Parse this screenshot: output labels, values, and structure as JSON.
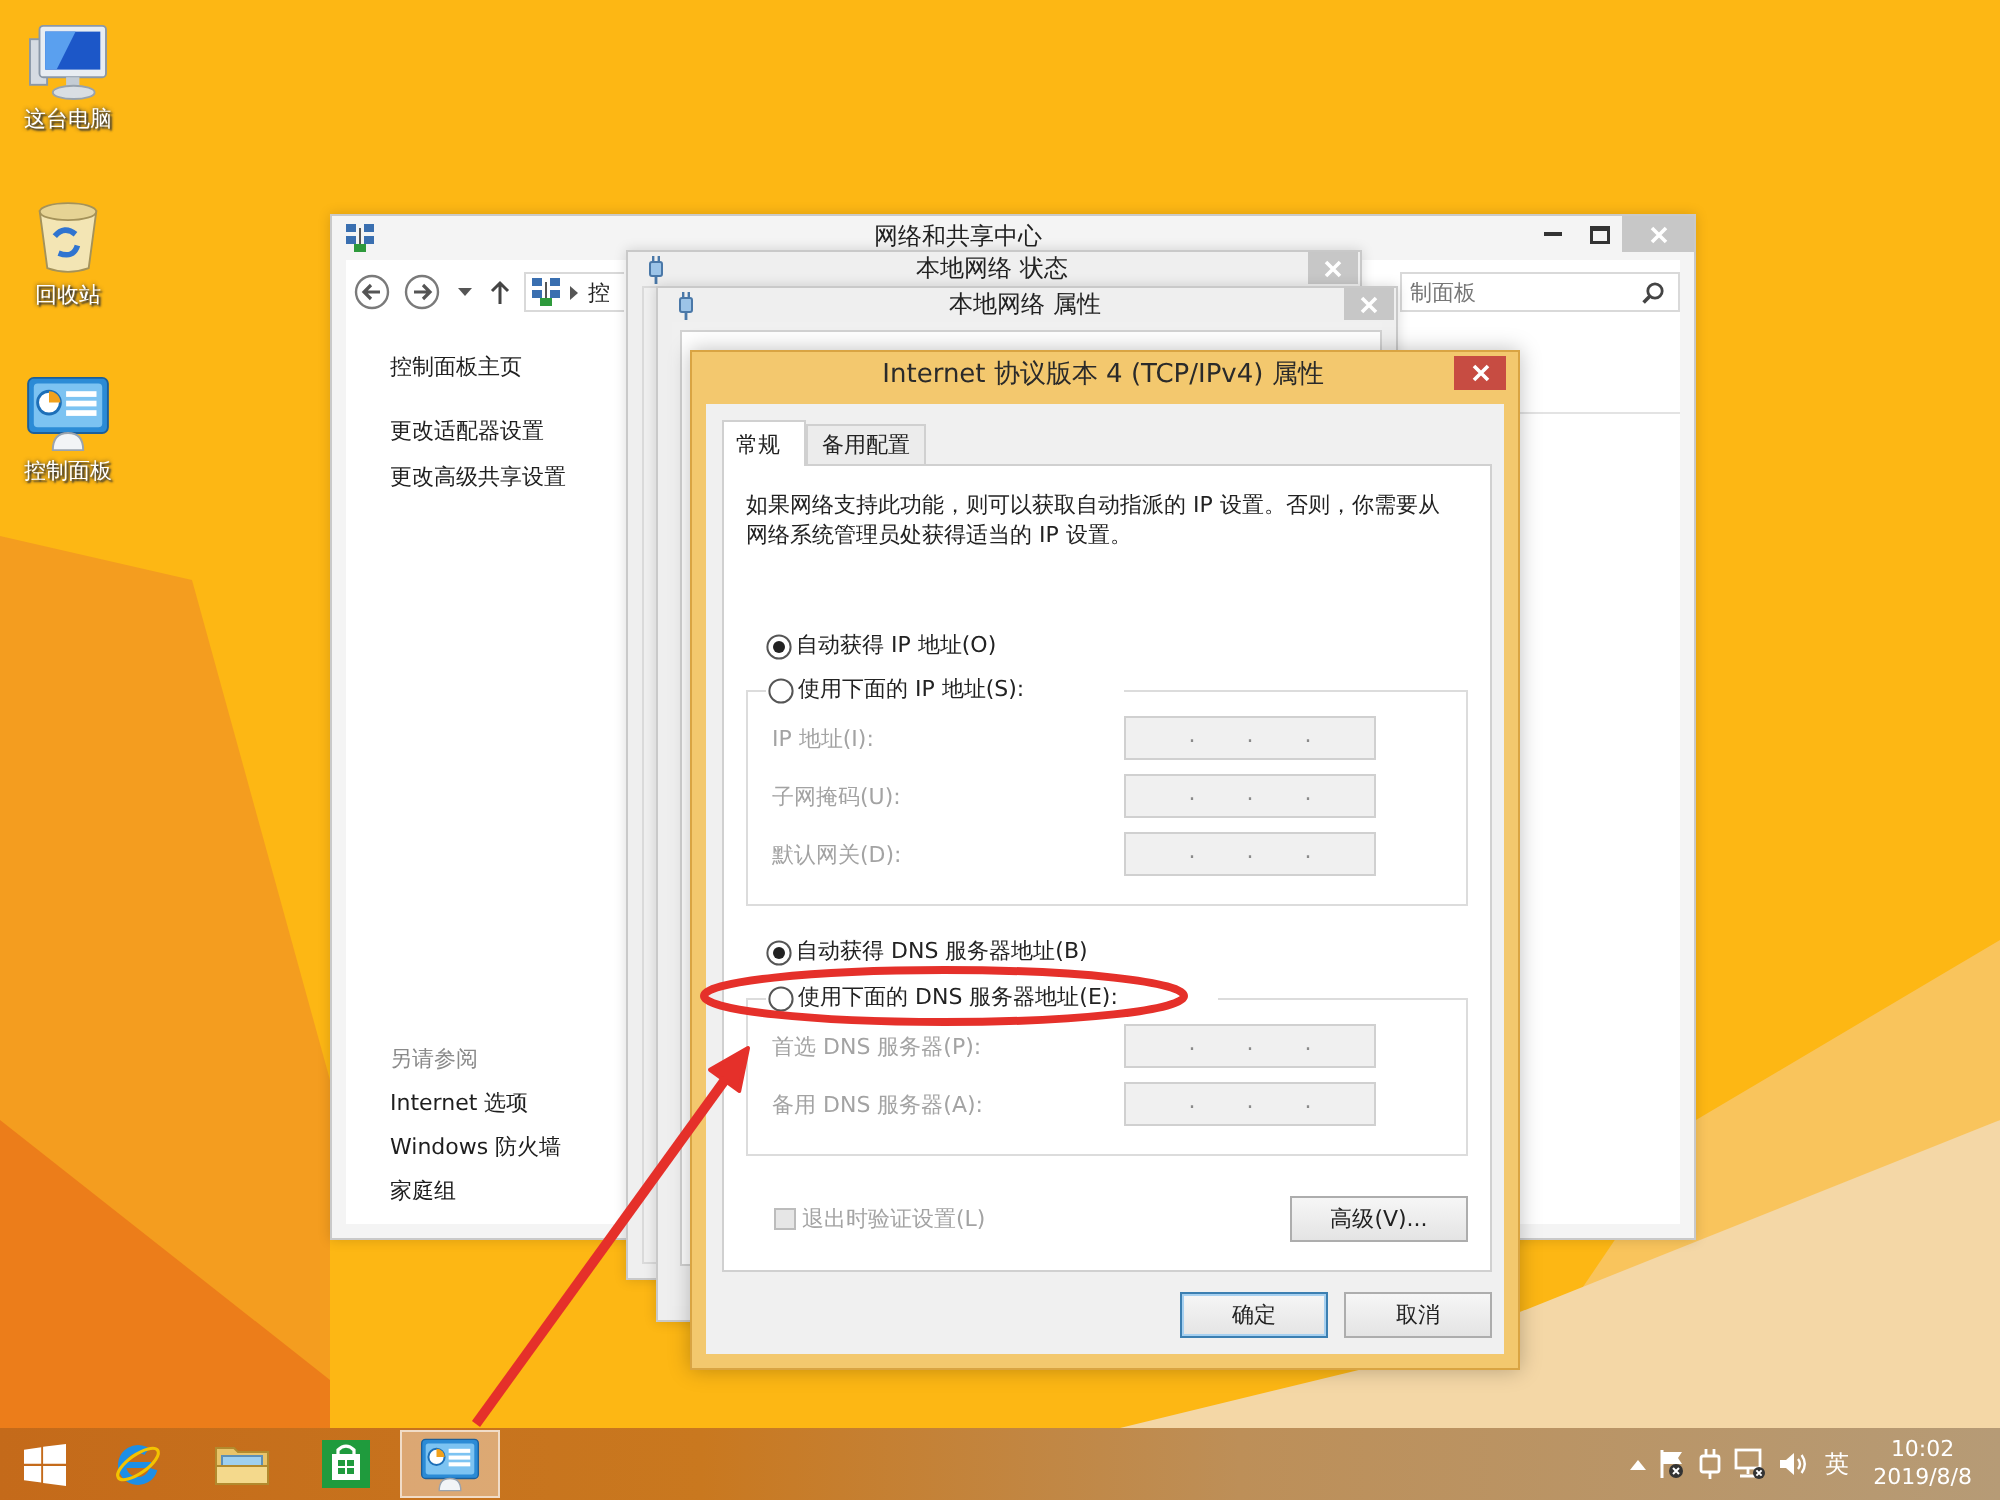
{
  "desktop_icons": [
    {
      "kind": "computer",
      "label": "这台电脑"
    },
    {
      "kind": "recycle_bin",
      "label": "回收站"
    },
    {
      "kind": "control_panel",
      "label": "控制面板"
    }
  ],
  "network_center": {
    "title": "网络和共享中心",
    "address_text": "控",
    "search_text": "制面板",
    "tasks": [
      "控制面板主页",
      "更改适配器设置",
      "更改高级共享设置"
    ],
    "see_also_heading": "另请参阅",
    "see_also": [
      "Internet 选项",
      "Windows 防火墙",
      "家庭组"
    ]
  },
  "status_window": {
    "title": "本地网络 状态"
  },
  "properties_window": {
    "title": "本地网络 属性"
  },
  "dialog": {
    "title": "Internet 协议版本 4 (TCP/IPv4) 属性",
    "tabs": [
      {
        "label": "常规",
        "selected": true
      },
      {
        "label": "备用配置",
        "selected": false
      }
    ],
    "description": "如果网络支持此功能，则可以获取自动指派的 IP 设置。否则，你需要从网络系统管理员处获得适当的 IP 设置。",
    "ip_options": [
      {
        "label": "自动获得 IP 地址(O)",
        "selected": true
      },
      {
        "label": "使用下面的 IP 地址(S):",
        "selected": false
      }
    ],
    "ip_fields": [
      {
        "label": "IP 地址(I):",
        "value": ". . .",
        "disabled": true
      },
      {
        "label": "子网掩码(U):",
        "value": ". . .",
        "disabled": true
      },
      {
        "label": "默认网关(D):",
        "value": ". . .",
        "disabled": true
      }
    ],
    "dns_options": [
      {
        "label": "自动获得 DNS 服务器地址(B)",
        "selected": true
      },
      {
        "label": "使用下面的 DNS 服务器地址(E):",
        "selected": false
      }
    ],
    "dns_fields": [
      {
        "label": "首选 DNS 服务器(P):",
        "value": ". . .",
        "disabled": true
      },
      {
        "label": "备用 DNS 服务器(A):",
        "value": ". . .",
        "disabled": true
      }
    ],
    "validate_option": {
      "label": "退出时验证设置(L)",
      "checked": false,
      "disabled": true
    },
    "advanced_button": "高级(V)...",
    "buttons": [
      {
        "label": "确定",
        "default": true
      },
      {
        "label": "取消",
        "default": false
      }
    ]
  },
  "taskbar": {
    "items": [
      {
        "kind": "browser",
        "selected": false
      },
      {
        "kind": "file_explorer",
        "selected": false
      },
      {
        "kind": "store",
        "selected": false
      },
      {
        "kind": "control_panel",
        "selected": true
      }
    ],
    "ime": "英",
    "time": "10:02",
    "date": "2019/8/8"
  }
}
